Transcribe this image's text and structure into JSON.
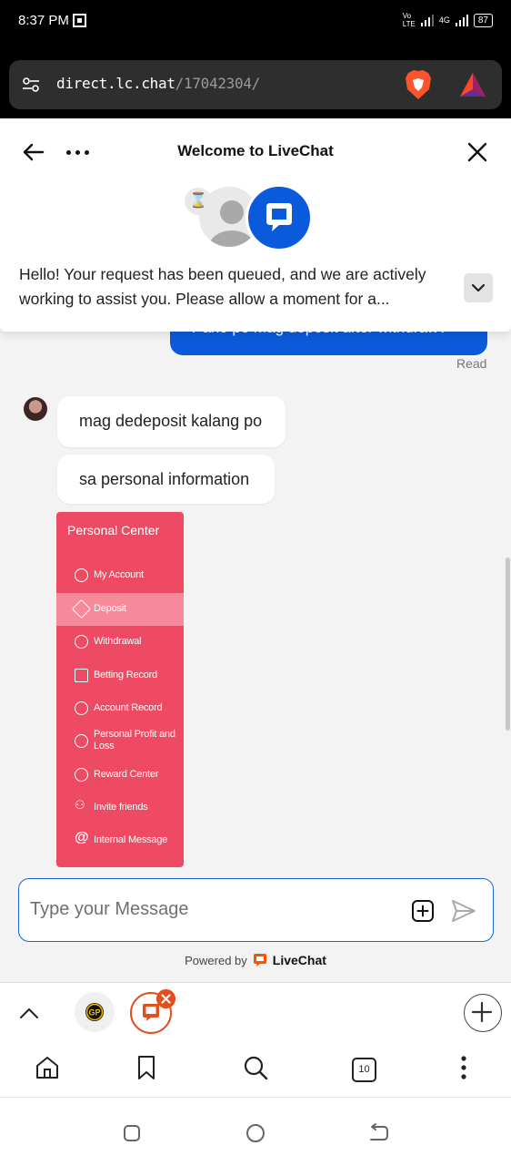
{
  "status_bar": {
    "time": "8:37 PM",
    "network_top": "Vo",
    "network_bottom": "LTE",
    "signal_label": "4G",
    "battery": "87"
  },
  "browser": {
    "url_domain": "direct.lc.chat",
    "url_path": "/17042304/"
  },
  "chat": {
    "title": "Welcome to LiveChat",
    "queue_message": "Hello! Your request has been queued, and we are actively working to assist you. Please allow a moment for a...",
    "sent_message": "Pano po mag deposit after withdraw?",
    "read_status": "Read",
    "messages": [
      "mag dedeposit kalang po",
      "sa personal information"
    ],
    "attachment": {
      "title": "Personal Center",
      "items": [
        "My Account",
        "Deposit",
        "Withdrawal",
        "Betting Record",
        "Account Record",
        "Personal Profit and Loss",
        "Reward Center",
        "Invite friends",
        "Internal Message"
      ],
      "active_item": "Deposit"
    },
    "input_placeholder": "Type your Message",
    "powered_by": "Powered by",
    "powered_brand": "LiveChat"
  },
  "bottom_bar": {
    "tab_count": "10",
    "site_badge": "GP"
  },
  "colors": {
    "livechat_blue": "#0a5adb",
    "brand_orange": "#e0501e",
    "card_red": "#ef4a64"
  }
}
